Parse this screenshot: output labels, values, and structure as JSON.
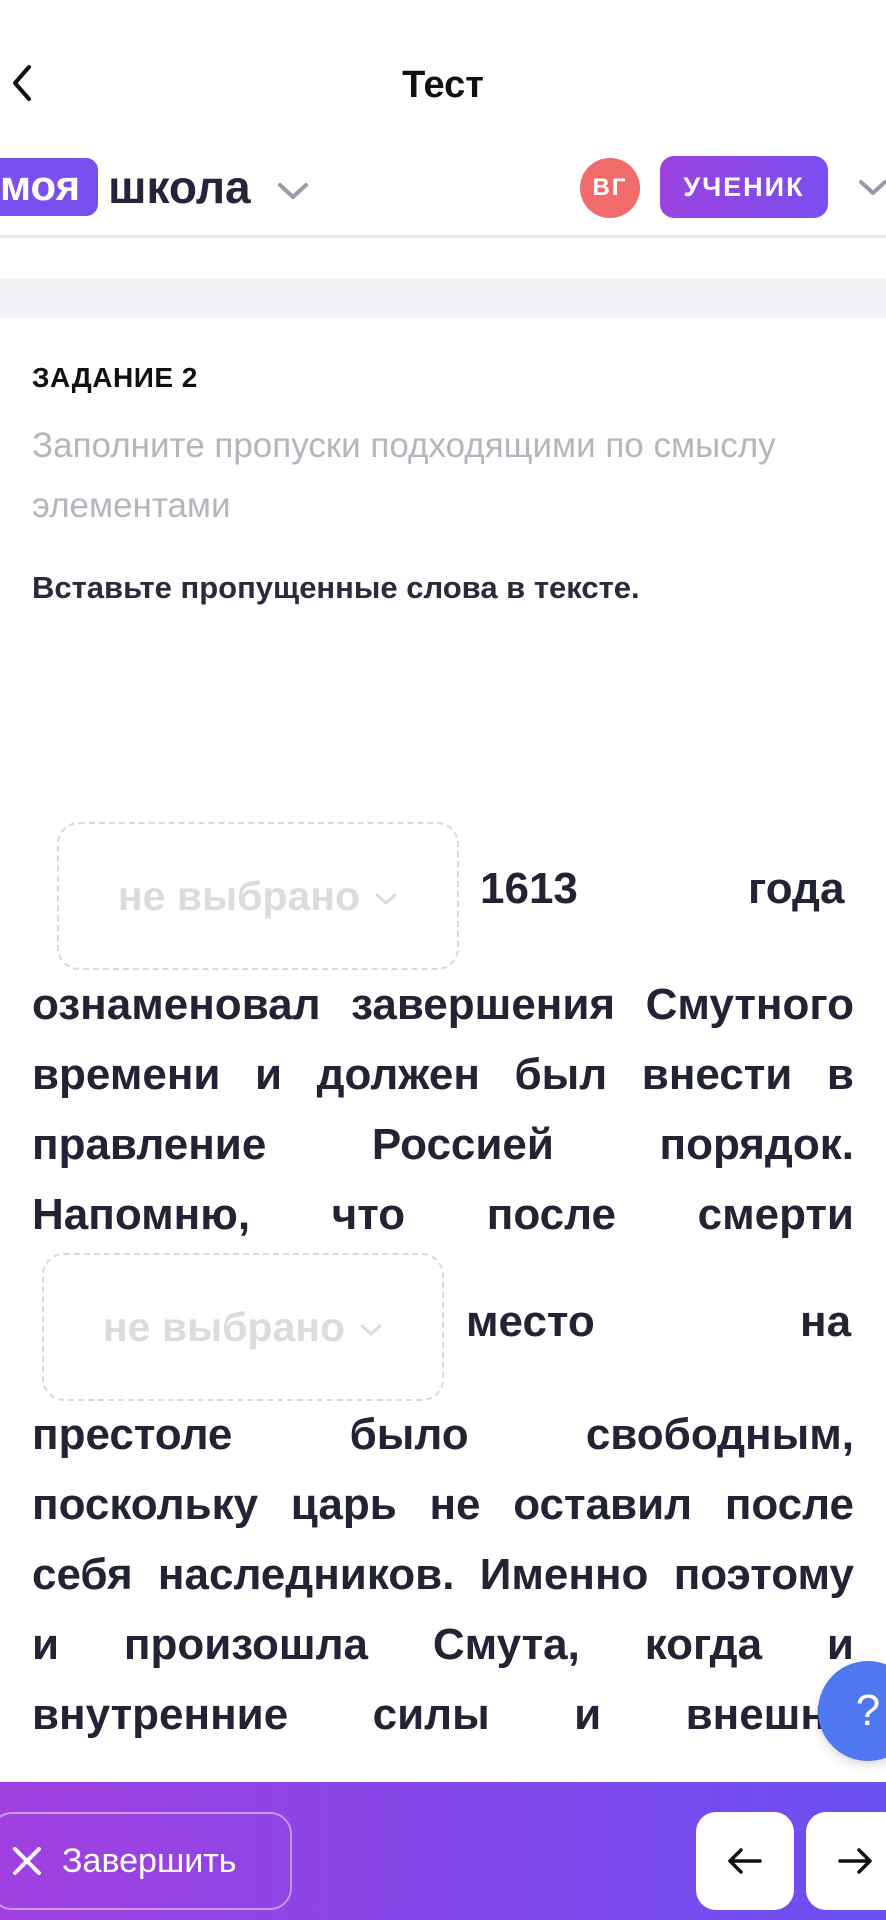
{
  "nav": {
    "title": "Тест",
    "back_icon": "chevron-left-icon"
  },
  "header": {
    "logo_part1": "моя",
    "logo_part2": "школа",
    "avatar_initials": "ВГ",
    "role": "УЧЕНИК"
  },
  "task": {
    "label": "ЗАДАНИЕ 2",
    "instruction": "Заполните пропуски подходящими по смыслу элементами",
    "prompt": "Вставьте пропущенные слова в тексте."
  },
  "text": {
    "dropdown_placeholder": "не выбрано",
    "after_dropdown_1": [
      "1613",
      "года"
    ],
    "line_1": [
      "ознаменовал",
      "завершения",
      "Смутного"
    ],
    "line_2": [
      "времени",
      "и",
      "должен",
      "был",
      "внести",
      "в"
    ],
    "line_3": [
      "правление",
      "Россией",
      "порядок."
    ],
    "line_4": [
      "Напомню,",
      "что",
      "после",
      "смерти"
    ],
    "after_dropdown_2": [
      "место",
      "на"
    ],
    "line_5": [
      "престоле",
      "было",
      "свободным,"
    ],
    "line_6": [
      "поскольку",
      "царь",
      "не",
      "оставил",
      "после"
    ],
    "line_7": [
      "себя",
      "наследников.",
      "Именно",
      "поэтому"
    ],
    "line_8": [
      "и",
      "произошла",
      "Смута,",
      "когда",
      "и"
    ],
    "line_9": [
      "внутренние",
      "силы",
      "и",
      "внешни"
    ]
  },
  "help": {
    "label": "?"
  },
  "bottom": {
    "finish_label": "Завершить",
    "prev_icon": "arrow-left-icon",
    "next_icon": "arrow-right-icon"
  },
  "colors": {
    "accent": "#7a4ff0",
    "avatar": "#f26b6b",
    "help": "#4f78f0"
  }
}
